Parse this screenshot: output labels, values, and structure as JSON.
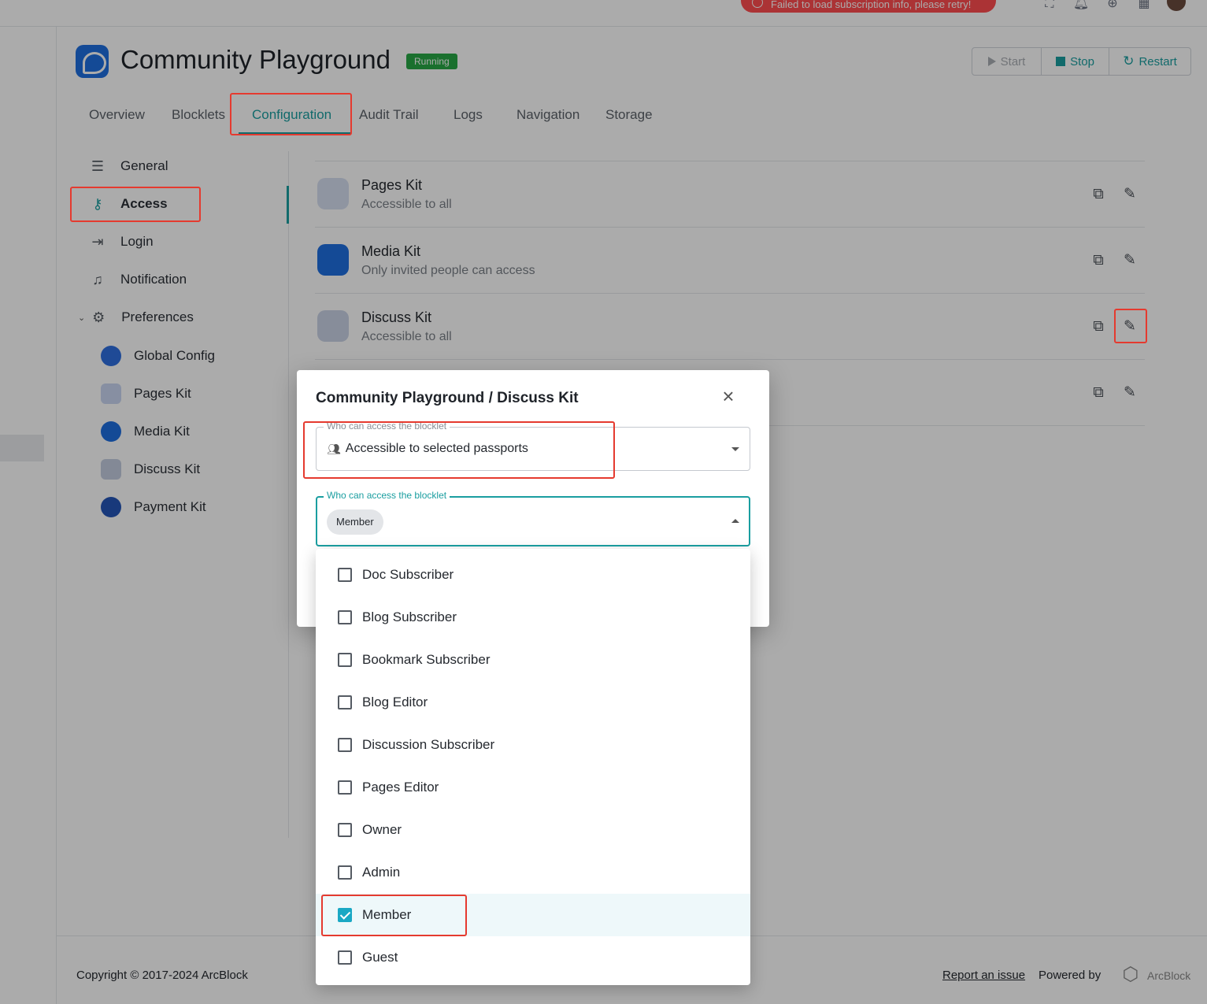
{
  "topbar": {
    "error_message": "Failed to load subscription info, please retry!",
    "icons": [
      "fullscreen-icon",
      "bell-icon",
      "globe-icon",
      "apps-icon",
      "user-avatar"
    ]
  },
  "header": {
    "title": "Community Playground",
    "status": "Running",
    "buttons": {
      "start": "Start",
      "stop": "Stop",
      "restart": "Restart"
    }
  },
  "tabs": [
    "Overview",
    "Blocklets",
    "Configuration",
    "Audit Trail",
    "Logs",
    "Navigation",
    "Storage"
  ],
  "active_tab": "Configuration",
  "sidebar": {
    "items": [
      {
        "label": "General",
        "icon": "sliders-icon"
      },
      {
        "label": "Access",
        "icon": "key-icon"
      },
      {
        "label": "Login",
        "icon": "login-icon"
      },
      {
        "label": "Notification",
        "icon": "bell-icon"
      },
      {
        "label": "Preferences",
        "icon": "gear-icon"
      }
    ],
    "preferences_children": [
      "Global Config",
      "Pages Kit",
      "Media Kit",
      "Discuss Kit",
      "Payment Kit"
    ],
    "active": "Access"
  },
  "kits": [
    {
      "name": "Pages Kit",
      "access": "Accessible to all"
    },
    {
      "name": "Media Kit",
      "access": "Only invited people can access"
    },
    {
      "name": "Discuss Kit",
      "access": "Accessible to all"
    }
  ],
  "dialog": {
    "title": "Community Playground / Discuss Kit",
    "field1_label": "Who can access the blocklet",
    "field1_value": "Accessible to selected passports",
    "field2_label": "Who can access the blocklet",
    "field2_chip": "Member",
    "options": [
      {
        "label": "Doc Subscriber",
        "checked": false
      },
      {
        "label": "Blog Subscriber",
        "checked": false
      },
      {
        "label": "Bookmark Subscriber",
        "checked": false
      },
      {
        "label": "Blog Editor",
        "checked": false
      },
      {
        "label": "Discussion Subscriber",
        "checked": false
      },
      {
        "label": "Pages Editor",
        "checked": false
      },
      {
        "label": "Owner",
        "checked": false
      },
      {
        "label": "Admin",
        "checked": false
      },
      {
        "label": "Member",
        "checked": true
      },
      {
        "label": "Guest",
        "checked": false
      }
    ]
  },
  "footer": {
    "copyright": "Copyright © 2017-2024  ArcBlock",
    "report_link": "Report an issue",
    "powered_by": "Powered by",
    "brand": "ArcBlock"
  },
  "colors": {
    "accent": "#1a9ea0",
    "running_badge": "#27a745",
    "error": "#ff4d4f",
    "checkbox_checked": "#1aa8c4",
    "annotation_red": "#e53a2f"
  }
}
